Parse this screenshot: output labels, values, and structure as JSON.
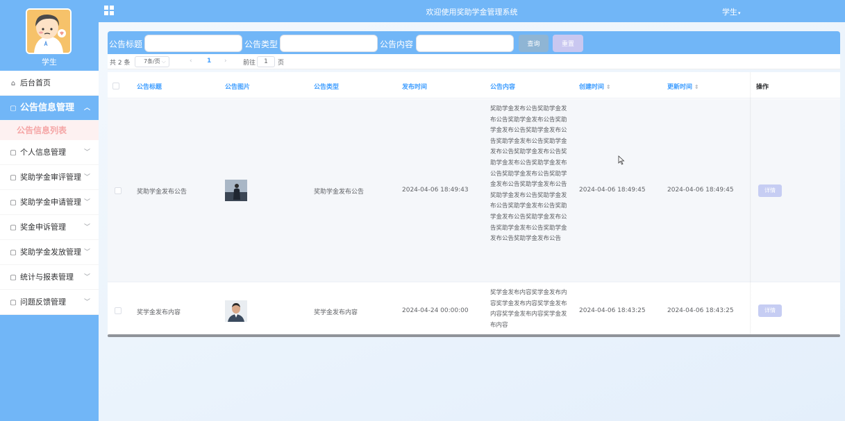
{
  "sidebar": {
    "username": "学生",
    "items": [
      {
        "label": "后台首页",
        "icon": "home-icon",
        "glyph": "⌂",
        "active": false,
        "expandable": false
      },
      {
        "label": "公告信息管理",
        "icon": "folder-icon",
        "glyph": "▢",
        "active": true,
        "expandable": true
      },
      {
        "label": "个人信息管理",
        "icon": "folder-icon",
        "glyph": "▢",
        "active": false,
        "expandable": true
      },
      {
        "label": "奖助学金审评管理",
        "icon": "folder-icon",
        "glyph": "▢",
        "active": false,
        "expandable": true
      },
      {
        "label": "奖助学金申请管理",
        "icon": "folder-icon",
        "glyph": "▢",
        "active": false,
        "expandable": true
      },
      {
        "label": "奖金申诉管理",
        "icon": "folder-icon",
        "glyph": "▢",
        "active": false,
        "expandable": true
      },
      {
        "label": "奖助学金发放管理",
        "icon": "folder-icon",
        "glyph": "▢",
        "active": false,
        "expandable": true
      },
      {
        "label": "统计与报表管理",
        "icon": "folder-icon",
        "glyph": "▢",
        "active": false,
        "expandable": true
      },
      {
        "label": "问题反馈管理",
        "icon": "folder-icon",
        "glyph": "▢",
        "active": false,
        "expandable": true
      }
    ],
    "sub_item": "公告信息列表"
  },
  "topbar": {
    "title": "欢迎使用奖助学金管理系统",
    "user": "学生"
  },
  "search": {
    "title_label": "公告标题",
    "type_label": "公告类型",
    "content_label": "公告内容",
    "title_value": "",
    "type_value": "",
    "content_value": "",
    "query_button": "查询",
    "reset_button": "重置"
  },
  "pager": {
    "total": "共 2 条",
    "page_size": "7条/页",
    "current_page": "1",
    "goto_label": "前往",
    "goto_value": "1",
    "page_suffix": "页"
  },
  "table": {
    "columns": [
      "公告标题",
      "公告图片",
      "公告类型",
      "发布时间",
      "公告内容",
      "创建时间",
      "更新时间",
      "操作"
    ],
    "rows": [
      {
        "title": "奖助学金发布公告",
        "type": "奖助学金发布公告",
        "publish_time": "2024-04-06 18:49:43",
        "content": "奖助学金发布公告奖助学金发布公告奖助学金发布公告奖助学金发布公告奖助学金发布公告奖助学金发布公告奖助学金发布公告奖助学金发布公告奖助学金发布公告奖助学金发布公告奖助学金发布公告奖助学金发布公告奖助学金发布公告奖助学金发布公告奖助学金发布公告奖助学金发布公告奖助学金发布公告奖助学金发布公告奖助学金发布公告奖助学金发布公告奖助学金发布公告",
        "created": "2024-04-06 18:49:45",
        "updated": "2024-04-06 18:49:45",
        "action": "详情"
      },
      {
        "title": "奖学金发布内容",
        "type": "奖学金发布内容",
        "publish_time": "2024-04-24 00:00:00",
        "content": "奖学金发布内容奖学金发布内容奖学金发布内容奖学金发布内容奖学金发布内容奖学金发布内容",
        "created": "2024-04-06 18:43:25",
        "updated": "2024-04-06 18:43:25",
        "action": "详情"
      }
    ]
  },
  "colors": {
    "primary": "#71b6f7",
    "header_text": "#409eff",
    "reset_button": "#c9c7f0",
    "query_button": "#8fb5d4",
    "detail_button": "#c6cdf3"
  }
}
